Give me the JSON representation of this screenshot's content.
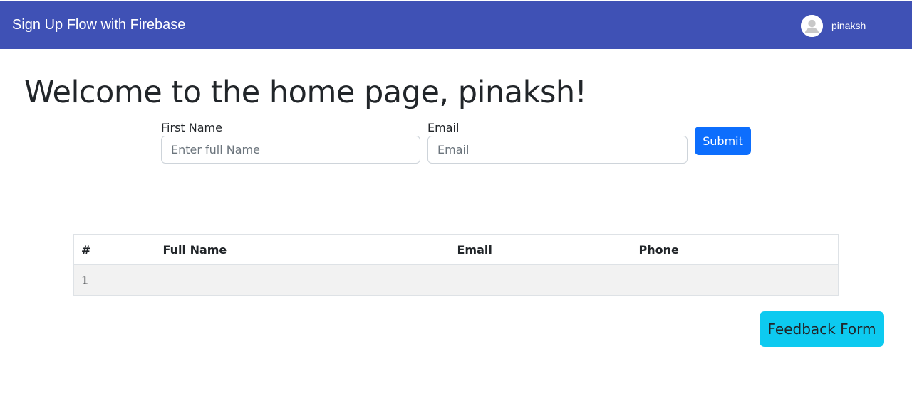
{
  "header": {
    "title": "Sign Up Flow with Firebase",
    "username": "pinaksh",
    "bg_color": "#3f51b5"
  },
  "main": {
    "heading": "Welcome to the home page, pinaksh!"
  },
  "form": {
    "first_name_label": "First Name",
    "first_name_placeholder": "Enter full Name",
    "first_name_value": "",
    "email_label": "Email",
    "email_placeholder": "Email",
    "email_value": "",
    "submit_label": "Submit"
  },
  "table": {
    "columns": [
      "#",
      "Full Name",
      "Email",
      "Phone"
    ],
    "rows": [
      [
        "1",
        "",
        "",
        ""
      ]
    ]
  },
  "feedback_button_label": "Feedback Form",
  "colors": {
    "primary_button": "#0d6efd",
    "info_button": "#0dcaf0"
  },
  "icons": {
    "avatar": "user-avatar-icon"
  }
}
